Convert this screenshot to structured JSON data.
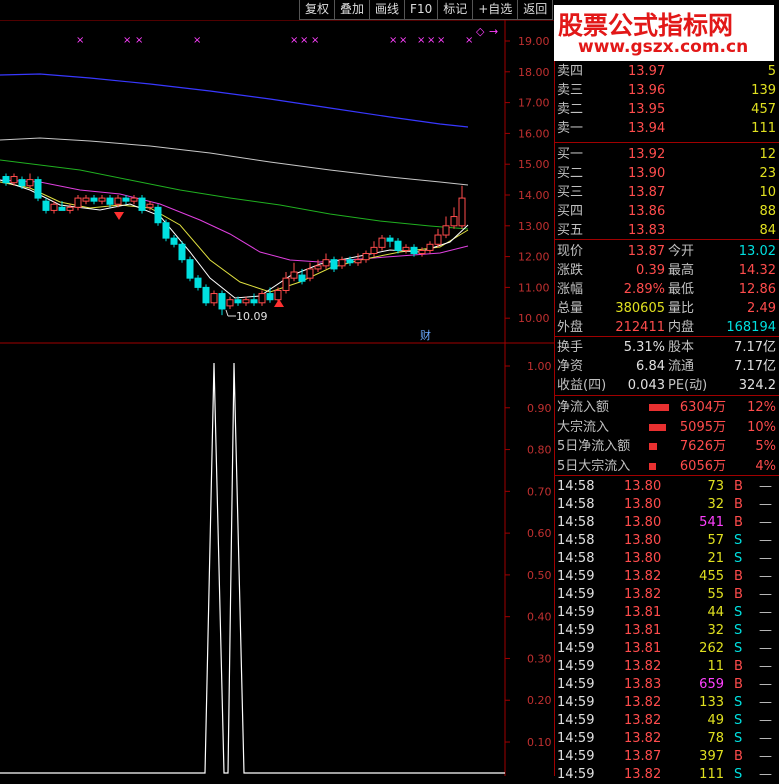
{
  "toolbar": {
    "items": [
      "复权",
      "叠加",
      "画线",
      "F10",
      "标记",
      "+自选",
      "返回"
    ]
  },
  "watermark": {
    "title": "股票公式指标网",
    "url": "www.gszx.com.cn"
  },
  "main_chart": {
    "y_axis_labels": [
      "19.00",
      "18.00",
      "17.00",
      "16.00",
      "15.00",
      "14.00",
      "13.00",
      "12.00",
      "11.00",
      "10.00"
    ],
    "low_annotation": "10.09",
    "cai_badge": "财",
    "top_marker_diamond": "◇",
    "top_marker_arrow": "→",
    "x_marker": "×"
  },
  "indicator_chart": {
    "y_axis_labels": [
      "1.00",
      "0.90",
      "0.80",
      "0.70",
      "0.60",
      "0.50",
      "0.40",
      "0.30",
      "0.20",
      "0.10"
    ]
  },
  "order_book": {
    "sell": [
      {
        "label": "卖四",
        "price": "13.97",
        "vol": "5"
      },
      {
        "label": "卖三",
        "price": "13.96",
        "vol": "139"
      },
      {
        "label": "卖二",
        "price": "13.95",
        "vol": "457"
      },
      {
        "label": "卖一",
        "price": "13.94",
        "vol": "111"
      }
    ],
    "buy": [
      {
        "label": "买一",
        "price": "13.92",
        "vol": "12"
      },
      {
        "label": "买二",
        "price": "13.90",
        "vol": "23"
      },
      {
        "label": "买三",
        "price": "13.87",
        "vol": "10"
      },
      {
        "label": "买四",
        "price": "13.86",
        "vol": "88"
      },
      {
        "label": "买五",
        "price": "13.83",
        "vol": "84"
      }
    ]
  },
  "quote": [
    {
      "l1": "现价",
      "v1": "13.87",
      "l2": "今开",
      "v2": "13.02"
    },
    {
      "l1": "涨跌",
      "v1": "0.39",
      "l2": "最高",
      "v2": "14.32"
    },
    {
      "l1": "涨幅",
      "v1": "2.89%",
      "l2": "最低",
      "v2": "12.86"
    },
    {
      "l1": "总量",
      "v1": "380605",
      "l2": "量比",
      "v2": "2.49"
    },
    {
      "l1": "外盘",
      "v1": "212411",
      "l2": "内盘",
      "v2": "168194"
    }
  ],
  "fundamentals": [
    {
      "l1": "换手",
      "v1": "5.31%",
      "l2": "股本",
      "v2": "7.17亿"
    },
    {
      "l1": "净资",
      "v1": "6.84",
      "l2": "流通",
      "v2": "7.17亿"
    },
    {
      "l1": "收益(四)",
      "v1": "0.043",
      "l2": "PE(动)",
      "v2": "324.2"
    }
  ],
  "fund_flow": [
    {
      "label": "净流入额",
      "amount": "6304万",
      "pct": "12%",
      "bar": 0.12
    },
    {
      "label": "大宗流入",
      "amount": "5095万",
      "pct": "10%",
      "bar": 0.1
    },
    {
      "label": "5日净流入额",
      "amount": "7626万",
      "pct": "5%",
      "bar": 0.05
    },
    {
      "label": "5日大宗流入",
      "amount": "6056万",
      "pct": "4%",
      "bar": 0.04
    }
  ],
  "ticks": [
    {
      "time": "14:58",
      "price": "13.80",
      "vol": "73",
      "side": "B",
      "extra": "—",
      "vcolor": "yellow"
    },
    {
      "time": "14:58",
      "price": "13.80",
      "vol": "32",
      "side": "B",
      "extra": "—",
      "vcolor": "yellow"
    },
    {
      "time": "14:58",
      "price": "13.80",
      "vol": "541",
      "side": "B",
      "extra": "—",
      "vcolor": "magenta"
    },
    {
      "time": "14:58",
      "price": "13.80",
      "vol": "57",
      "side": "S",
      "extra": "—",
      "vcolor": "yellow"
    },
    {
      "time": "14:58",
      "price": "13.80",
      "vol": "21",
      "side": "S",
      "extra": "—",
      "vcolor": "yellow"
    },
    {
      "time": "14:59",
      "price": "13.82",
      "vol": "455",
      "side": "B",
      "extra": "—",
      "vcolor": "yellow"
    },
    {
      "time": "14:59",
      "price": "13.82",
      "vol": "55",
      "side": "B",
      "extra": "—",
      "vcolor": "yellow"
    },
    {
      "time": "14:59",
      "price": "13.81",
      "vol": "44",
      "side": "S",
      "extra": "—",
      "vcolor": "yellow"
    },
    {
      "time": "14:59",
      "price": "13.81",
      "vol": "32",
      "side": "S",
      "extra": "—",
      "vcolor": "yellow"
    },
    {
      "time": "14:59",
      "price": "13.81",
      "vol": "262",
      "side": "S",
      "extra": "—",
      "vcolor": "yellow"
    },
    {
      "time": "14:59",
      "price": "13.82",
      "vol": "11",
      "side": "B",
      "extra": "—",
      "vcolor": "yellow"
    },
    {
      "time": "14:59",
      "price": "13.83",
      "vol": "659",
      "side": "B",
      "extra": "—",
      "vcolor": "magenta"
    },
    {
      "time": "14:59",
      "price": "13.82",
      "vol": "133",
      "side": "S",
      "extra": "—",
      "vcolor": "yellow"
    },
    {
      "time": "14:59",
      "price": "13.82",
      "vol": "49",
      "side": "S",
      "extra": "—",
      "vcolor": "yellow"
    },
    {
      "time": "14:59",
      "price": "13.82",
      "vol": "78",
      "side": "S",
      "extra": "—",
      "vcolor": "yellow"
    },
    {
      "time": "14:59",
      "price": "13.87",
      "vol": "397",
      "side": "B",
      "extra": "—",
      "vcolor": "yellow"
    },
    {
      "time": "14:59",
      "price": "13.82",
      "vol": "111",
      "side": "S",
      "extra": "—",
      "vcolor": "yellow"
    }
  ],
  "colors": {
    "panel_border": "#a00000",
    "up": "#ff4c4c",
    "down": "#00e0e0",
    "ma_blue": "#3838ff",
    "ma_grey": "#c8c8c8",
    "ma_green": "#20b020",
    "ma_magenta": "#e040e0",
    "ma_yellow": "#e0e040",
    "ma_white": "#ffffff"
  }
}
